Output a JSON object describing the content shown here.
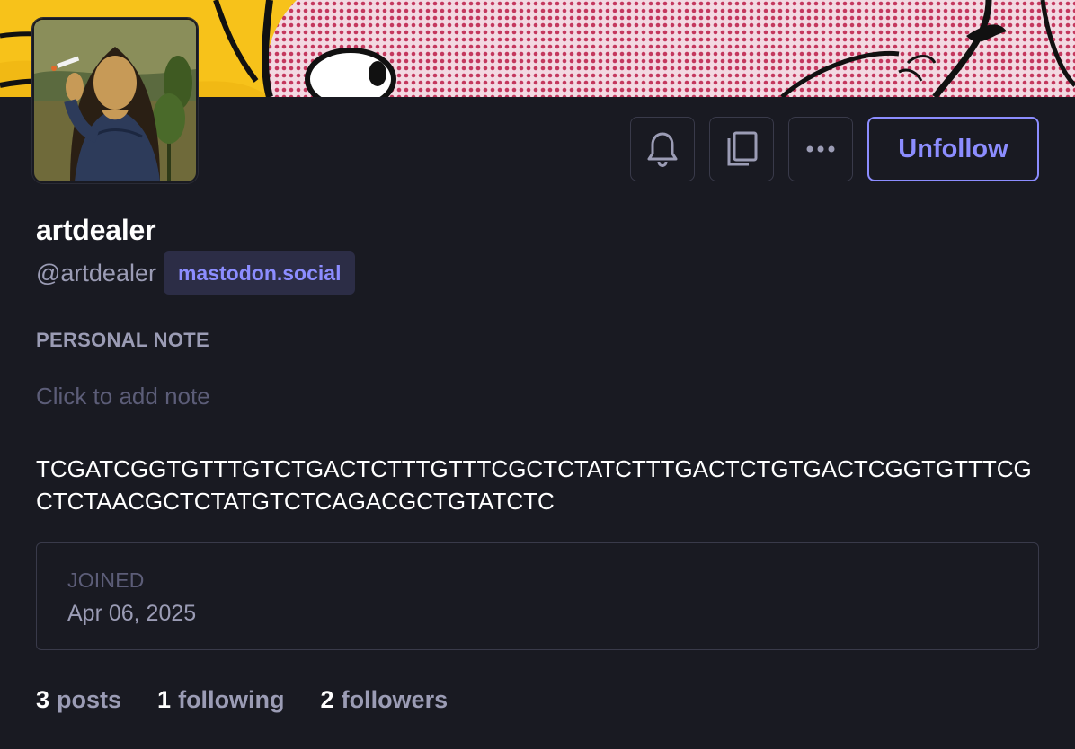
{
  "profile": {
    "display_name": "artdealer",
    "username": "@artdealer",
    "domain": "mastodon.social",
    "bio": "TCGATCGGTGTTTGTCTGACTCTTTGTTTCGCTCTATCTTTGACTCTGTGACTCGGTGTTTCGCTCTAACGCTCTATGTCTCAGACGCTGTATCTC"
  },
  "actions": {
    "notify_icon": "bell-icon",
    "copy_icon": "copy-icon",
    "more_icon": "ellipsis-icon",
    "unfollow_label": "Unfollow"
  },
  "personal_note": {
    "label": "PERSONAL NOTE",
    "placeholder": "Click to add note"
  },
  "joined": {
    "label": "JOINED",
    "date": "Apr 06, 2025"
  },
  "stats": {
    "posts_count": "3",
    "posts_label": "posts",
    "following_count": "1",
    "following_label": "following",
    "followers_count": "2",
    "followers_label": "followers"
  },
  "colors": {
    "background": "#191a22",
    "accent": "#8c8dff",
    "muted_text": "#9b9cb5",
    "dim_text": "#5c5d78",
    "border": "#393a4a",
    "badge_bg": "#2c2d46"
  }
}
